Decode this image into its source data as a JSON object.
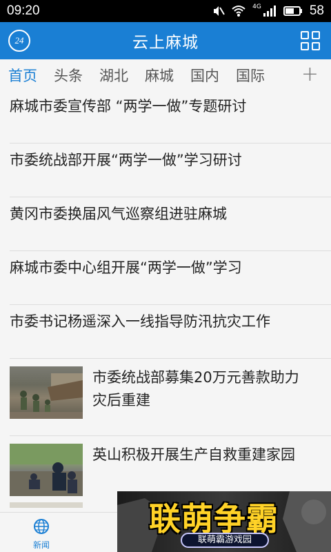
{
  "status_bar": {
    "time": "09:20",
    "network": "4G",
    "battery": "58",
    "icons": [
      "mute-icon",
      "wifi-icon",
      "signal-icon",
      "battery-icon"
    ]
  },
  "app_bar": {
    "logo_text": "24",
    "title": "云上麻城",
    "menu_icon": "grid-icon"
  },
  "tabs": {
    "items": [
      {
        "label": "首页",
        "active": true
      },
      {
        "label": "头条",
        "active": false
      },
      {
        "label": "湖北",
        "active": false
      },
      {
        "label": "麻城",
        "active": false
      },
      {
        "label": "国内",
        "active": false
      },
      {
        "label": "国际",
        "active": false
      }
    ],
    "add_label": "+"
  },
  "news": {
    "text_items": [
      {
        "title": "麻城市委宣传部 “两学一做”专题研讨"
      },
      {
        "title": "市委统战部开展“两学一做”学习研讨"
      },
      {
        "title": "黄冈市委换届风气巡察组进驻麻城"
      },
      {
        "title": "麻城市委中心组开展“两学一做”学习"
      },
      {
        "title": "市委书记杨遥深入一线指导防汛抗灾工作"
      }
    ],
    "image_items": [
      {
        "title": "市委统战部募集20万元善款助力灾后重建"
      },
      {
        "title": "英山积极开展生产自救重建家园"
      }
    ]
  },
  "bottom_nav": {
    "items": [
      {
        "label": "新闻",
        "icon": "globe-icon",
        "active": true
      }
    ]
  },
  "ad": {
    "title": "联萌争霸",
    "subtitle": "联萌霸游戏园"
  },
  "colors": {
    "accent": "#1a7fd4",
    "status_bar": "#000000",
    "ad_title": "#ffd227"
  }
}
